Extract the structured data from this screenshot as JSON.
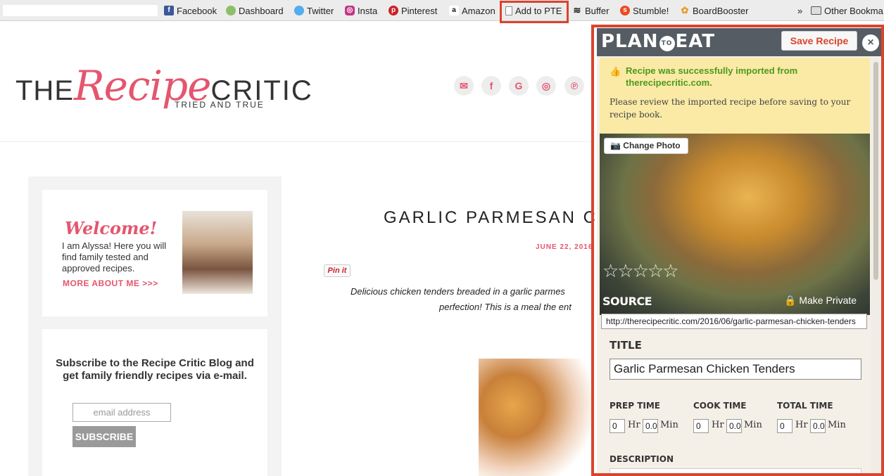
{
  "bookmarks": {
    "items": [
      {
        "label": "Facebook",
        "icon": "facebook-icon"
      },
      {
        "label": "Dashboard",
        "icon": "dashboard-icon"
      },
      {
        "label": "Twitter",
        "icon": "twitter-icon"
      },
      {
        "label": "Insta",
        "icon": "instagram-icon"
      },
      {
        "label": "Pinterest",
        "icon": "pinterest-icon"
      },
      {
        "label": "Amazon",
        "icon": "amazon-icon"
      },
      {
        "label": "Add to PTE",
        "icon": "page-icon"
      },
      {
        "label": "Buffer",
        "icon": "buffer-icon"
      },
      {
        "label": "Stumble!",
        "icon": "stumbleupon-icon"
      },
      {
        "label": "BoardBooster",
        "icon": "boardbooster-icon"
      }
    ],
    "overflow": "»",
    "other": "Other Bookma"
  },
  "site": {
    "logo_the": "THE",
    "logo_recipe": "Recipe",
    "logo_critic": "CRITIC",
    "tagline": "TRIED AND TRUE",
    "social": [
      "✉",
      "f",
      "G",
      "◎",
      "℗"
    ]
  },
  "sidebar": {
    "welcome_title": "Welcome!",
    "welcome_text": "I am Alyssa! Here you will find family tested and approved recipes.",
    "welcome_link": "MORE ABOUT ME >>>",
    "subscribe_text": "Subscribe to the Recipe Critic Blog and get family friendly recipes via e-mail.",
    "email_placeholder": "email address",
    "subscribe_button": "SUBSCRIBE"
  },
  "post": {
    "title": "GARLIC PARMESAN CH",
    "date": "JUNE 22, 2016",
    "pinit": "Pin it",
    "desc_line1": "Delicious chicken tenders breaded in a garlic parmes",
    "desc_line2": "perfection!  This is a meal the ent"
  },
  "pte": {
    "logo_plan": "PLAN",
    "logo_to": "TO",
    "logo_eat": "EAT",
    "save_button": "Save Recipe",
    "close": "×",
    "alert_title": "Recipe was successfully imported from therecipecritic.com.",
    "alert_message": "Please review the imported recipe before saving to your recipe book.",
    "change_photo": "Change Photo",
    "stars": "☆☆☆☆☆",
    "rating": 0,
    "source_label": "SOURCE",
    "make_private": "Make Private",
    "source_url": "http://therecipecritic.com/2016/06/garlic-parmesan-chicken-tenders",
    "title_label": "TITLE",
    "title_value": "Garlic Parmesan Chicken Tenders",
    "prep_label": "PREP TIME",
    "cook_label": "COOK TIME",
    "total_label": "TOTAL TIME",
    "hr_value": "0",
    "min_value": "0.0",
    "hr_unit": "Hr",
    "min_unit": "Min",
    "description_label": "DESCRIPTION"
  },
  "colors": {
    "accent_red": "#d9442d",
    "brand_pink": "#e4566f",
    "success_green": "#4c9a1c",
    "alert_yellow": "#faeaa6",
    "header_gray": "#555c63"
  }
}
